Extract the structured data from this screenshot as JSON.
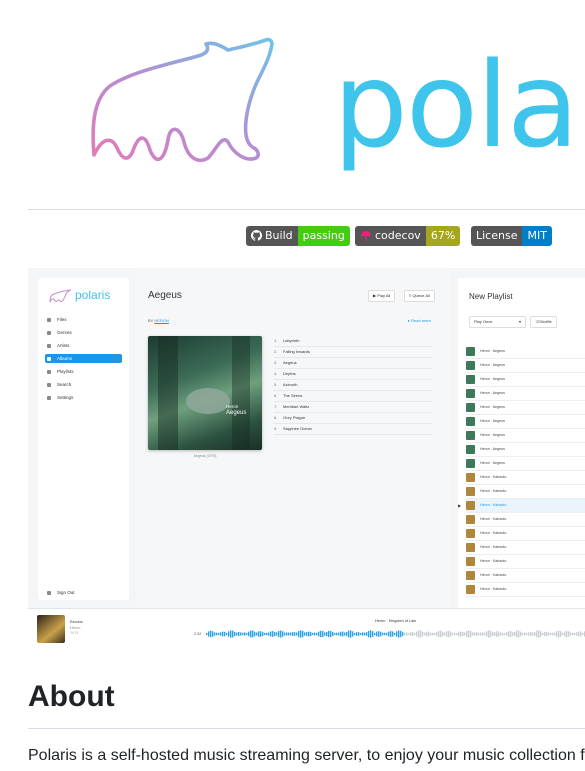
{
  "logo": {
    "wordmark": "pola",
    "bear_icon": "polar-bear-icon"
  },
  "badges": [
    {
      "label": "Build",
      "value": "passing",
      "icon": "github-icon",
      "color": "#4c1"
    },
    {
      "label": "codecov",
      "value": "67%",
      "icon": "codecov-umbrella-icon",
      "color": "#a4a61d"
    },
    {
      "label": "License",
      "value": "MIT",
      "color": "#007ec6"
    }
  ],
  "app": {
    "brand": "polaris",
    "sidebar": [
      {
        "label": "Files",
        "icon": "folder-icon"
      },
      {
        "label": "Genres",
        "icon": "tag-icon"
      },
      {
        "label": "Artists",
        "icon": "person-icon"
      },
      {
        "label": "Albums",
        "icon": "album-icon",
        "active": true
      },
      {
        "label": "Playlists",
        "icon": "playlist-icon"
      },
      {
        "label": "Search",
        "icon": "search-icon"
      },
      {
        "label": "Settings",
        "icon": "gear-icon"
      }
    ],
    "sign_out": "Sign Out",
    "album": {
      "title": "Aegeus",
      "by_prefix": "BY",
      "artist": "HERON",
      "read_more": "▸ Read more",
      "play_all": "▶ Play All",
      "queue_all": "≡ Queue All",
      "cover_artist": "Heron",
      "cover_title": "Aegeus",
      "caption": "Aegeus (1975)",
      "tracks": [
        {
          "n": "1.",
          "title": "Labyrinth"
        },
        {
          "n": "2.",
          "title": "Falling Inwards"
        },
        {
          "n": "3.",
          "title": "Aegeus"
        },
        {
          "n": "4.",
          "title": "Depths"
        },
        {
          "n": "5.",
          "title": "Azimuth"
        },
        {
          "n": "6.",
          "title": "The Sirens"
        },
        {
          "n": "7.",
          "title": "Meridian Waltz"
        },
        {
          "n": "8.",
          "title": "Grey Plague"
        },
        {
          "n": "9.",
          "title": "Sapphire Ocean"
        }
      ]
    },
    "playlist": {
      "title": "New Playlist",
      "select": "Play Once",
      "shuffle": "⤨ Shuffle",
      "rows": [
        {
          "text": "Heron · Aegeus",
          "color": "#3c7a5a"
        },
        {
          "text": "Heron · Aegeus",
          "color": "#3c7a5a"
        },
        {
          "text": "Heron · Aegeus",
          "color": "#3c7a5a"
        },
        {
          "text": "Heron · Aegeus",
          "color": "#3c7a5a"
        },
        {
          "text": "Heron · Aegeus",
          "color": "#3c7a5a"
        },
        {
          "text": "Heron · Aegeus",
          "color": "#3c7a5a"
        },
        {
          "text": "Heron · Aegeus",
          "color": "#3c7a5a"
        },
        {
          "text": "Heron · Aegeus",
          "color": "#3c7a5a"
        },
        {
          "text": "Heron · Aegeus",
          "color": "#3c7a5a"
        },
        {
          "text": "Heron · Kairaoto",
          "color": "#b0863a"
        },
        {
          "text": "Heron · Kairaoto",
          "color": "#b0863a"
        },
        {
          "text": "Heron · Kairaoto",
          "color": "#b0863a",
          "current": true
        },
        {
          "text": "Heron · Kairaoto",
          "color": "#b0863a"
        },
        {
          "text": "Heron · Kairaoto",
          "color": "#b0863a"
        },
        {
          "text": "Heron · Kairaoto",
          "color": "#b0863a"
        },
        {
          "text": "Heron · Kairaoto",
          "color": "#b0863a"
        },
        {
          "text": "Heron · Kairaoto",
          "color": "#b0863a"
        },
        {
          "text": "Heron · Kairaoto",
          "color": "#b0863a"
        }
      ]
    },
    "player": {
      "track": "Exodus",
      "artist": "Heron",
      "year": "1975",
      "now_playing": "Heron · Kingdom of Lain",
      "elapsed": "2:32",
      "progress": 0.52
    }
  },
  "about": {
    "heading": "About",
    "description": "Polaris is a self-hosted music streaming server, to enjoy your music collection f"
  }
}
